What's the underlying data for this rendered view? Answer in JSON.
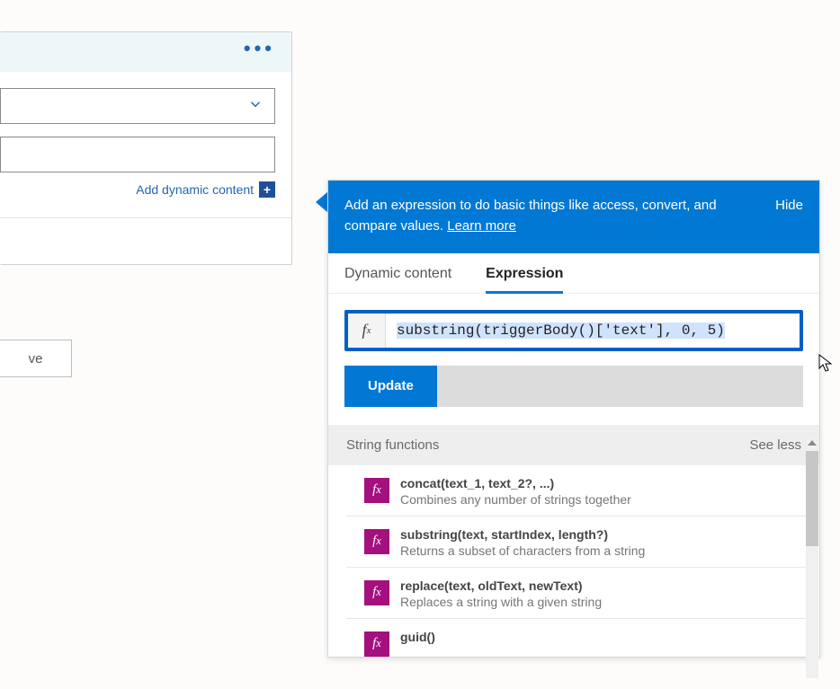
{
  "left_card": {
    "add_dynamic_content_label": "Add dynamic content"
  },
  "save_button_label": "ve",
  "popover": {
    "header_text": "Add an expression to do basic things like access, convert, and compare values.",
    "learn_more_label": "Learn more",
    "hide_label": "Hide",
    "tabs": {
      "dynamic": "Dynamic content",
      "expression": "Expression",
      "active": "expression"
    },
    "expression_value": "substring(triggerBody()['text'], 0, 5)",
    "update_label": "Update",
    "functions_section": {
      "title": "String functions",
      "toggle_label": "See less",
      "items": [
        {
          "sig": "concat(text_1, text_2?, ...)",
          "desc": "Combines any number of strings together"
        },
        {
          "sig": "substring(text, startIndex, length?)",
          "desc": "Returns a subset of characters from a string"
        },
        {
          "sig": "replace(text, oldText, newText)",
          "desc": "Replaces a string with a given string"
        },
        {
          "sig": "guid()",
          "desc": ""
        }
      ]
    }
  }
}
